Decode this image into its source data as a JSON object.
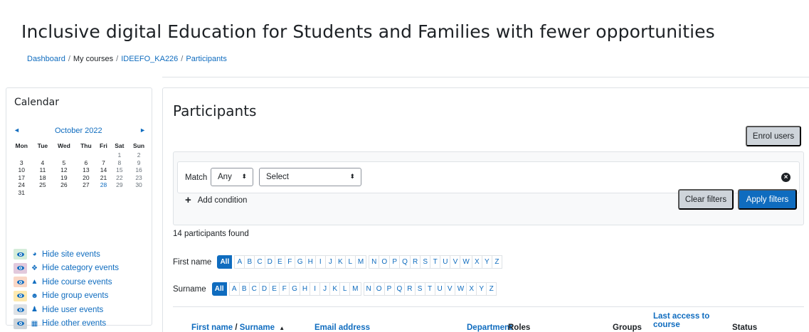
{
  "header": {
    "title": "Inclusive digital Education for Students and Families with fewer opportunities",
    "breadcrumb": [
      "Dashboard",
      "My courses",
      "IDEEFO_KA226",
      "Participants"
    ]
  },
  "calendar": {
    "title": "Calendar",
    "month": "October 2022",
    "prev_glyph": "◄",
    "next_glyph": "►",
    "weekdays": [
      "Mon",
      "Tue",
      "Wed",
      "Thu",
      "Fri",
      "Sat",
      "Sun"
    ],
    "weeks": [
      [
        "",
        "",
        "",
        "",
        "",
        "1",
        "2"
      ],
      [
        "3",
        "4",
        "5",
        "6",
        "7",
        "8",
        "9"
      ],
      [
        "10",
        "11",
        "12",
        "13",
        "14",
        "15",
        "16"
      ],
      [
        "17",
        "18",
        "19",
        "20",
        "21",
        "22",
        "23"
      ],
      [
        "24",
        "25",
        "26",
        "27",
        "28",
        "29",
        "30"
      ],
      [
        "31",
        "",
        "",
        "",
        "",
        "",
        ""
      ]
    ],
    "today": "28",
    "events": [
      {
        "label": "Hide site events",
        "icon": "globe-icon",
        "glyph": "◕",
        "bg": "#d4edda"
      },
      {
        "label": "Hide category events",
        "icon": "cubes-icon",
        "glyph": "❖",
        "bg": "#e2c9dc"
      },
      {
        "label": "Hide course events",
        "icon": "graduation-cap-icon",
        "glyph": "▲",
        "bg": "#fad7c6"
      },
      {
        "label": "Hide group events",
        "icon": "users-icon",
        "glyph": "☻",
        "bg": "#fde9b0"
      },
      {
        "label": "Hide user events",
        "icon": "user-icon",
        "glyph": "♟",
        "bg": "#dee2e6"
      },
      {
        "label": "Hide other events",
        "icon": "calendar-icon",
        "glyph": "▦",
        "bg": "#ced4da"
      }
    ]
  },
  "participants": {
    "title": "Participants",
    "enrol_label": "Enrol users",
    "filter": {
      "match_label": "Match",
      "match_value": "Any",
      "select_value": "Select",
      "add_condition": "Add condition",
      "clear_label": "Clear filters",
      "apply_label": "Apply filters"
    },
    "found_text": "14 participants found",
    "firstname_label": "First name",
    "surname_label": "Surname",
    "all_label": "All",
    "letters": [
      "A",
      "B",
      "C",
      "D",
      "E",
      "F",
      "G",
      "H",
      "I",
      "J",
      "K",
      "L",
      "M",
      "N",
      "O",
      "P",
      "Q",
      "R",
      "S",
      "T",
      "U",
      "V",
      "W",
      "X",
      "Y",
      "Z"
    ],
    "columns": {
      "first_name": "First name",
      "slash": " / ",
      "surname": "Surname",
      "sort_glyph": "▲",
      "email": "Email address",
      "department": "Department",
      "roles": "Roles",
      "groups": "Groups",
      "last_access_1": "Last access to",
      "last_access_2": "course",
      "status": "Status"
    }
  },
  "colors": {
    "link": "#0f6cbf",
    "primary": "#0f6cbf",
    "secondary": "#ced4da"
  }
}
